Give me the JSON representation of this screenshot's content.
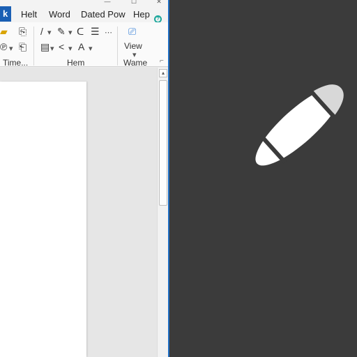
{
  "titlebar": {
    "minimize": "—",
    "maximize": "☐",
    "close": "✕"
  },
  "tabs": [
    {
      "label": "k"
    },
    {
      "label": "Helt"
    },
    {
      "label": "Word"
    },
    {
      "label": "Dated Pow"
    },
    {
      "label": "Hep"
    }
  ],
  "ribbon": {
    "groups": [
      {
        "label": "Time..."
      },
      {
        "label": "Hem"
      },
      {
        "label": "Wame"
      }
    ],
    "view_label": "View",
    "launcher": "⌐"
  },
  "icons": {
    "help": "help-icon",
    "pen": "stylus-pen-icon"
  },
  "colors": {
    "active_tab": "#1a5fb4",
    "window_border": "#1f6fc4",
    "help_accent": "#1aa79b",
    "right_pane": "#3b3b3b"
  }
}
